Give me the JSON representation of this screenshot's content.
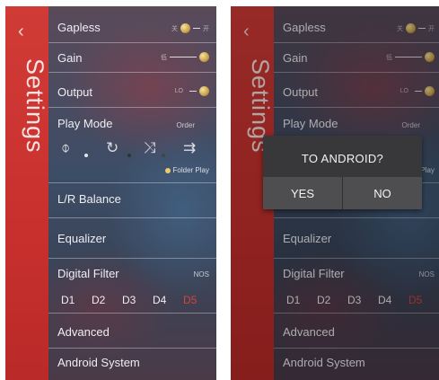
{
  "sidebar": {
    "title": "Settings",
    "back_glyph": "‹"
  },
  "settings": {
    "gapless": {
      "label": "Gapless",
      "off_label": "关",
      "on_label": "开"
    },
    "gain": {
      "label": "Gain",
      "low_label": "低"
    },
    "output": {
      "label": "Output",
      "lo_label": "LO"
    },
    "play_mode": {
      "label": "Play Mode",
      "value": "Order",
      "folder_play_label": "Folder Play",
      "icons": [
        "single-repeat-icon",
        "repeat-icon",
        "shuffle-icon",
        "order-icon"
      ]
    },
    "lr_balance": {
      "label": "L/R Balance"
    },
    "equalizer": {
      "label": "Equalizer"
    },
    "digital_filter": {
      "label": "Digital Filter",
      "value": "NOS",
      "options": [
        "D1",
        "D2",
        "D3",
        "D4",
        "D5"
      ],
      "selected": "D5"
    },
    "advanced": {
      "label": "Advanced"
    },
    "android_system": {
      "label": "Android System"
    }
  },
  "dialog": {
    "title": "TO ANDROID?",
    "yes_label": "YES",
    "no_label": "NO"
  },
  "colors": {
    "sidebar": "#c8302d",
    "selected_filter": "#d6433c",
    "knob": "#c9a24a"
  }
}
